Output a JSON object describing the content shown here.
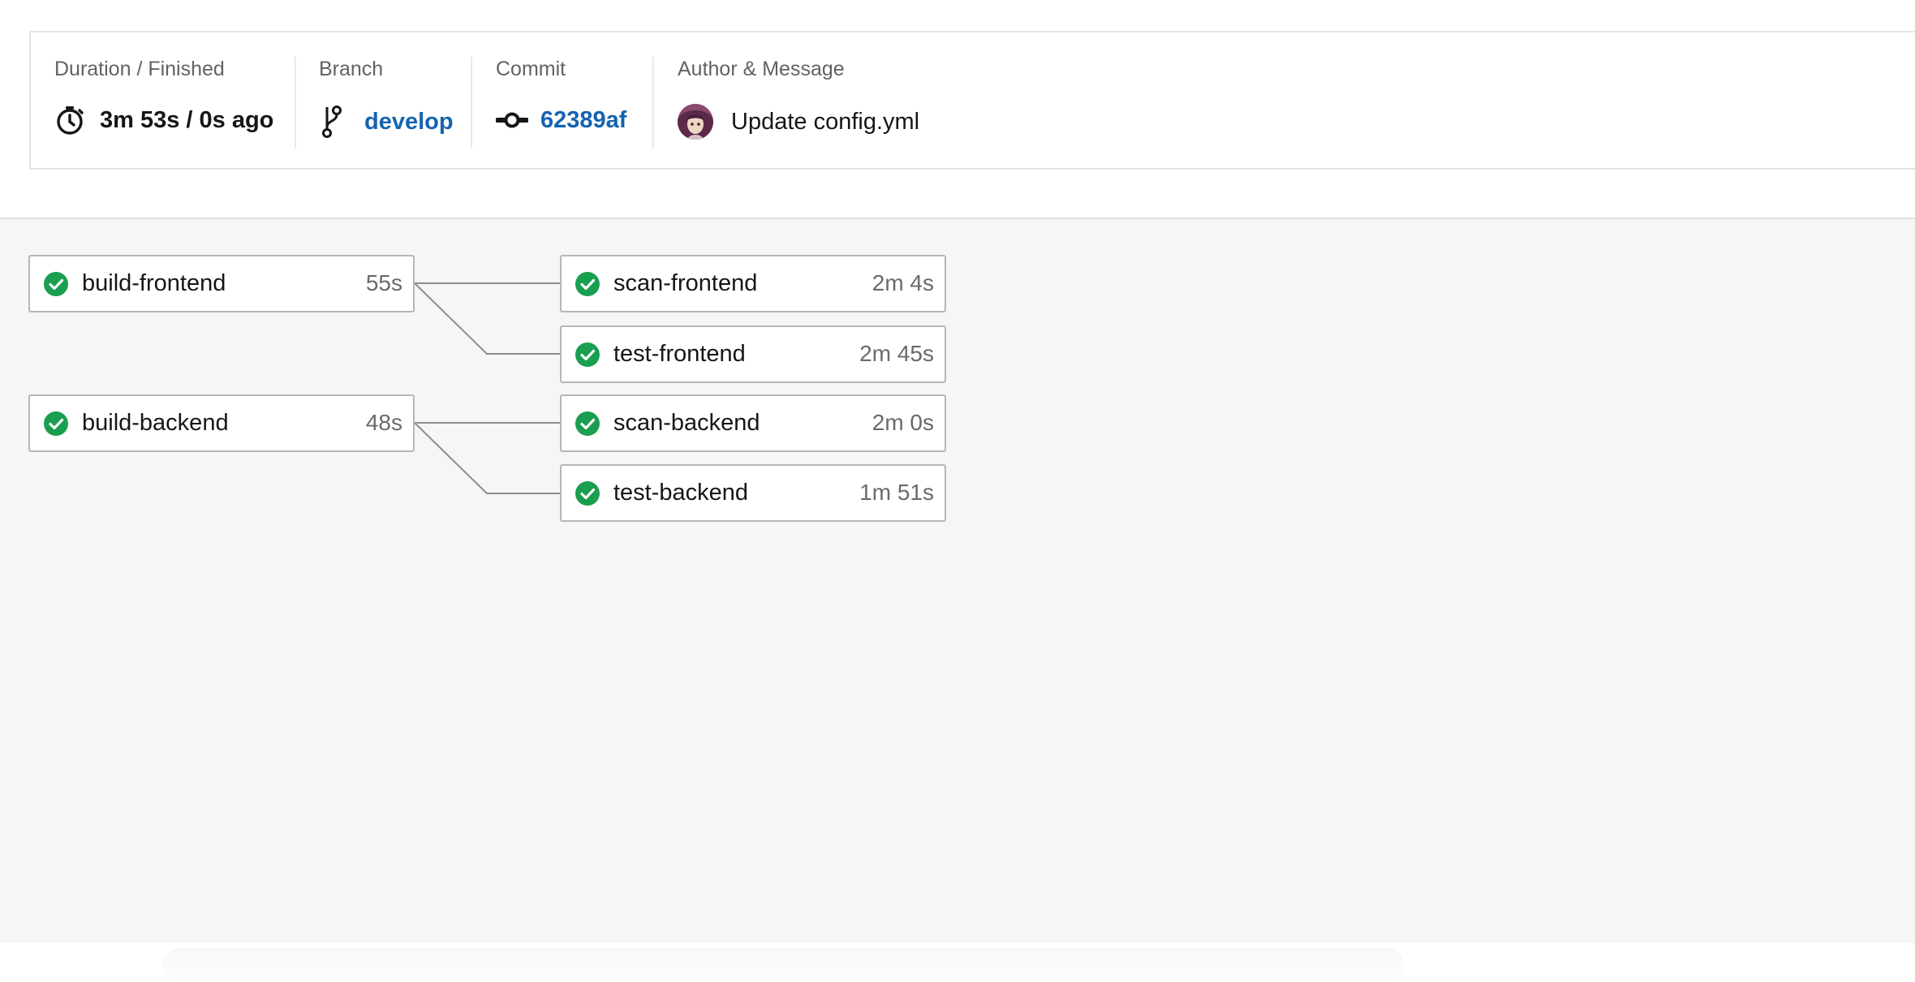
{
  "summary": {
    "duration": {
      "label": "Duration / Finished",
      "value": "3m 53s / 0s ago",
      "icon": "stopwatch-icon"
    },
    "branch": {
      "label": "Branch",
      "value": "develop",
      "icon": "git-branch-icon"
    },
    "commit": {
      "label": "Commit",
      "value": "62389af",
      "icon": "git-commit-icon"
    },
    "author": {
      "label": "Author & Message",
      "message": "Update config.yml",
      "icon": "avatar"
    }
  },
  "colors": {
    "link": "#1563b0",
    "success": "#1a9e4f",
    "canvas": "#f6f6f6",
    "border": "#b6b6b6"
  },
  "jobs": [
    {
      "name": "build-frontend",
      "duration": "55s",
      "status": "success"
    },
    {
      "name": "scan-frontend",
      "duration": "2m 4s",
      "status": "success"
    },
    {
      "name": "test-frontend",
      "duration": "2m 45s",
      "status": "success"
    },
    {
      "name": "build-backend",
      "duration": "48s",
      "status": "success"
    },
    {
      "name": "scan-backend",
      "duration": "2m 0s",
      "status": "success"
    },
    {
      "name": "test-backend",
      "duration": "1m 51s",
      "status": "success"
    }
  ]
}
